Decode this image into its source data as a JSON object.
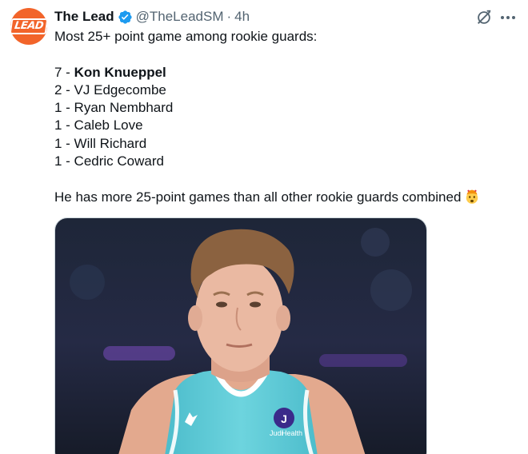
{
  "author": {
    "display_name": "The Lead",
    "handle": "@TheLeadSM",
    "separator": "·",
    "time": "4h",
    "avatar_text": "LEAD",
    "verified_icon": "verified-badge-icon"
  },
  "tweet": {
    "lines": [
      {
        "prefix": "Most 25+ point game among rookie guards:",
        "bold": ""
      },
      {
        "prefix": "",
        "bold": ""
      },
      {
        "prefix": "7 - ",
        "bold": "Kon Knueppel"
      },
      {
        "prefix": "2 - VJ Edgecombe",
        "bold": ""
      },
      {
        "prefix": "1 - Ryan Nembhard",
        "bold": ""
      },
      {
        "prefix": "1 - Caleb Love",
        "bold": ""
      },
      {
        "prefix": "1 - Will Richard",
        "bold": ""
      },
      {
        "prefix": "1 - Cedric Coward",
        "bold": ""
      },
      {
        "prefix": "",
        "bold": ""
      },
      {
        "prefix": "He has more 25-point games than all other rookie guards combined",
        "bold": ""
      }
    ],
    "emoji": "exploding-head-emoji"
  },
  "media": {
    "jersey_sponsor_line1": "Judi",
    "jersey_sponsor_line2": "Health",
    "jersey_logo_letter": "J",
    "colors": {
      "jersey": "#5ccbd6",
      "background": "#1a2030",
      "skin": "#e8b8a0",
      "hair": "#8a6040"
    }
  },
  "icons": {
    "grok": "grok-icon",
    "more": "more-icon"
  },
  "colors": {
    "accent": "#1d9bf0",
    "avatar_bg": "#f2642a",
    "secondary_text": "#536471"
  }
}
